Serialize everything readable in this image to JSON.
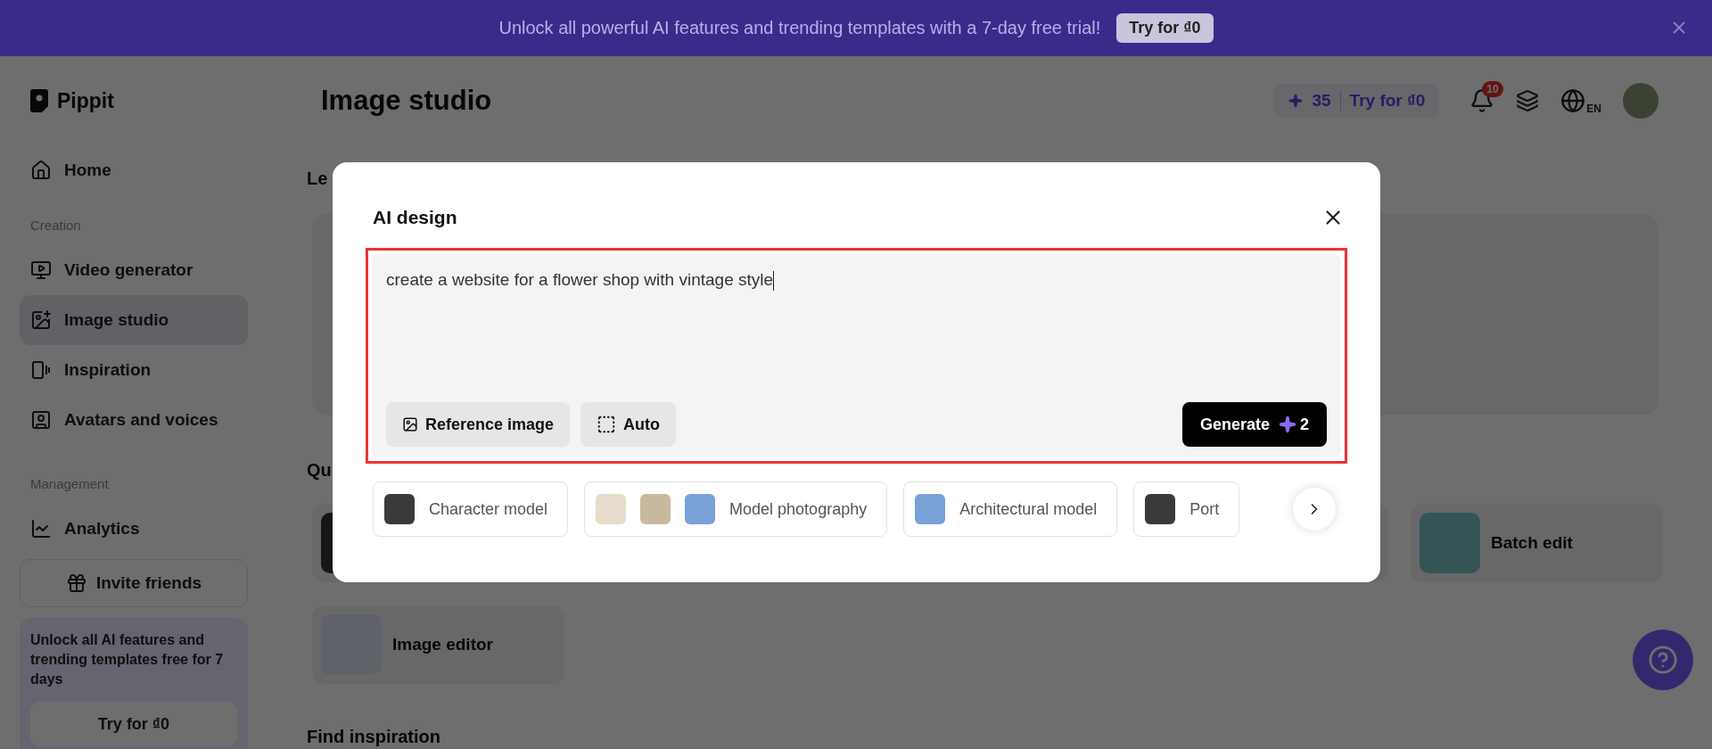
{
  "banner": {
    "text": "Unlock all powerful AI features and trending templates with a 7-day free trial!",
    "button": "Try for ₫0"
  },
  "header": {
    "logo": "Pippit",
    "title": "Image studio",
    "credits": "35",
    "trial_button": "Try for ₫0",
    "notification_count": "10",
    "language": "EN"
  },
  "sidebar": {
    "items": [
      {
        "kind": "nav",
        "label": "Home",
        "selected": false
      },
      {
        "kind": "section",
        "label": "Creation"
      },
      {
        "kind": "nav",
        "label": "Video generator",
        "selected": false
      },
      {
        "kind": "nav",
        "label": "Image studio",
        "selected": true
      },
      {
        "kind": "nav",
        "label": "Inspiration",
        "selected": false
      },
      {
        "kind": "nav",
        "label": "Avatars and voices",
        "selected": false
      },
      {
        "kind": "section",
        "label": "Management"
      },
      {
        "kind": "nav",
        "label": "Analytics",
        "selected": false
      }
    ],
    "invite_button": "Invite friends",
    "promo": {
      "text": "Unlock all AI features and trending templates free for 7 days",
      "button": "Try for ₫0"
    }
  },
  "main": {
    "headings": [
      "Le",
      "Qu"
    ],
    "tools": [
      {
        "label": "Batch edit"
      },
      {
        "label": "Image editor"
      }
    ],
    "find_heading": "Find inspiration"
  },
  "modal": {
    "title": "AI design",
    "prompt": "create a website for a flower shop with vintage style",
    "options": [
      {
        "kind": "reference",
        "label": "Reference image"
      },
      {
        "kind": "auto",
        "label": "Auto"
      }
    ],
    "generate": {
      "label": "Generate",
      "cost": "2"
    },
    "chips": [
      {
        "kind": "single",
        "label": "Character model"
      },
      {
        "kind": "triple",
        "label": "Model photography"
      },
      {
        "kind": "single",
        "label": "Architectural model"
      },
      {
        "kind": "single",
        "label": "Port"
      }
    ]
  }
}
